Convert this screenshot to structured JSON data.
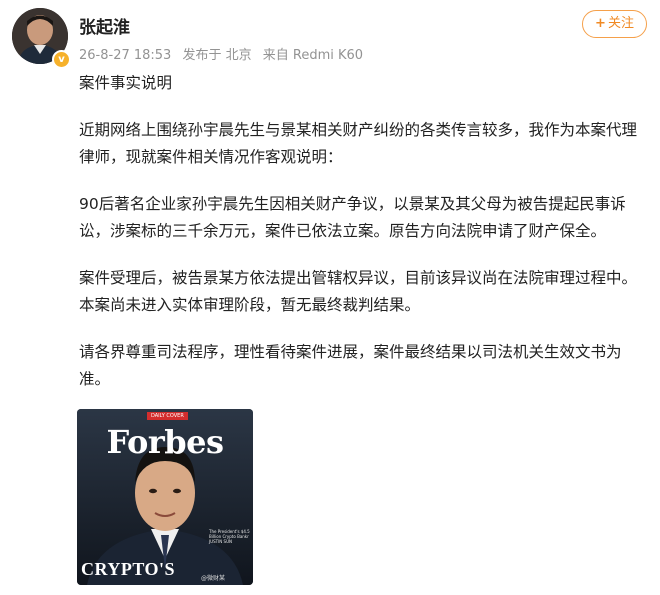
{
  "user": {
    "name": "张起淮",
    "verified_icon": "v-badge-icon"
  },
  "meta": {
    "timestamp": "26-8-27 18:53",
    "location": "发布于 北京",
    "device": "来自 Redmi K60"
  },
  "follow": {
    "icon": "+",
    "label": "关注",
    "accent": "#f08a24"
  },
  "post": {
    "title": "案件事实说明",
    "paragraphs": [
      "近期网络上围绕孙宇晨先生与景某相关财产纠纷的各类传言较多，我作为本案代理律师，现就案件相关情况作客观说明：",
      "90后著名企业家孙宇晨先生因相关财产争议，以景某及其父母为被告提起民事诉讼，涉案标的三千余万元，案件已依法立案。原告方向法院申请了财产保全。",
      "案件受理后，被告景某方依法提出管辖权异议，目前该异议尚在法院审理过程中。本案尚未进入实体审理阶段，暂无最终裁判结果。",
      "请各界尊重司法程序，理性看待案件进展，案件最终结果以司法机关生效文书为准。"
    ]
  },
  "image": {
    "cover_badge": "DAILY COVER",
    "masthead": "Forbes",
    "headline": "CRYPTO'S",
    "side_text": "The President's $4.5 Billion Crypto Bankr JUSTIN SUN",
    "watermark": "@微财某"
  }
}
